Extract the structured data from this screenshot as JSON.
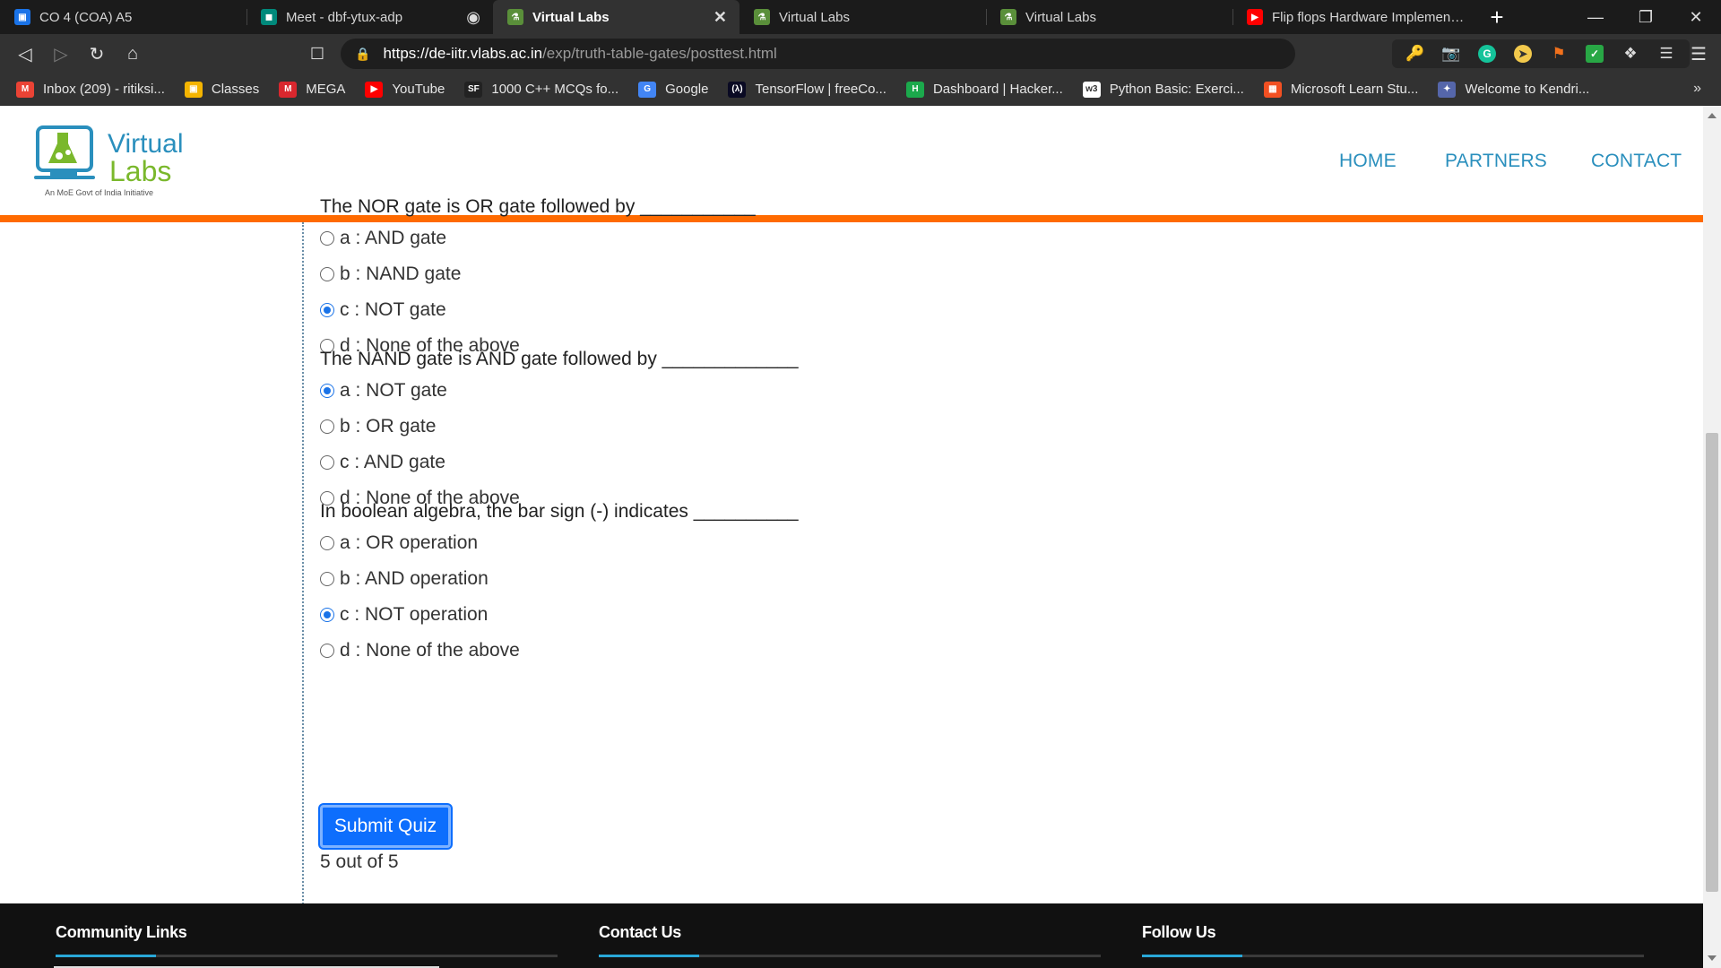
{
  "browser": {
    "tabs": [
      {
        "title": "CO 4 (COA) A5",
        "icon": "classroom-icon",
        "color": "#1a73e8",
        "active": false
      },
      {
        "title": "Meet - dbf-ytux-adp",
        "icon": "meet-icon",
        "color": "#00897b",
        "active": false,
        "recording": true
      },
      {
        "title": "Virtual Labs",
        "icon": "virtual-labs-icon",
        "color": "#5a8f3a",
        "active": true
      },
      {
        "title": "Virtual Labs",
        "icon": "virtual-labs-icon",
        "color": "#5a8f3a",
        "active": false
      },
      {
        "title": "Virtual Labs",
        "icon": "virtual-labs-icon",
        "color": "#5a8f3a",
        "active": false
      },
      {
        "title": "Flip flops Hardware Implementation",
        "icon": "youtube-icon",
        "color": "#ff0000",
        "active": false
      }
    ],
    "url_host": "https://de-iitr.vlabs.ac.in",
    "url_path": "/exp/truth-table-gates/posttest.html",
    "shield_badge": "1",
    "rewards_badge": "1",
    "bookmarks": [
      {
        "label": "Inbox (209) - ritiksi...",
        "icon": "gmail-icon",
        "color": "#ea4335",
        "glyph": "M"
      },
      {
        "label": "Classes",
        "icon": "classroom-icon",
        "color": "#f4b400",
        "glyph": "▣"
      },
      {
        "label": "MEGA",
        "icon": "mega-icon",
        "color": "#d9272e",
        "glyph": "M"
      },
      {
        "label": "YouTube",
        "icon": "youtube-icon",
        "color": "#ff0000",
        "glyph": "▶"
      },
      {
        "label": "1000 C++ MCQs fo...",
        "icon": "sanfoundry-icon",
        "color": "#222222",
        "glyph": "SF"
      },
      {
        "label": "Google",
        "icon": "google-icon",
        "color": "#4285f4",
        "glyph": "G"
      },
      {
        "label": "TensorFlow | freeCo...",
        "icon": "freecodecamp-icon",
        "color": "#0a0a23",
        "glyph": "(λ)"
      },
      {
        "label": "Dashboard | Hacker...",
        "icon": "hackerrank-icon",
        "color": "#1ba94c",
        "glyph": "H"
      },
      {
        "label": "Python Basic: Exerci...",
        "icon": "w3resource-icon",
        "color": "#ffffff",
        "glyph": "w3"
      },
      {
        "label": "Microsoft Learn Stu...",
        "icon": "microsoft-icon",
        "color": "#f25022",
        "glyph": "▦"
      },
      {
        "label": "Welcome to Kendri...",
        "icon": "kendriya-icon",
        "color": "#5566aa",
        "glyph": "✦"
      }
    ]
  },
  "site": {
    "logo_text_top": "Virtual",
    "logo_text_bottom": "Labs",
    "logo_tagline": "An MoE Govt of India Initiative",
    "nav": {
      "home": "HOME",
      "partners": "PARTNERS",
      "contact": "CONTACT"
    },
    "accent_color": "#ff6a00",
    "link_color": "#2a8fbd"
  },
  "quiz": {
    "questions": [
      {
        "text": "The NOR gate is OR gate followed by ___________",
        "options": [
          "a : AND gate",
          "b : NAND gate",
          "c : NOT gate",
          "d : None of the above"
        ],
        "selected": 2
      },
      {
        "text": "The NAND gate is AND gate followed by _____________",
        "options": [
          "a : NOT gate",
          "b : OR gate",
          "c : AND gate",
          "d : None of the above"
        ],
        "selected": 0
      },
      {
        "text": "In boolean algebra, the bar sign (-) indicates __________",
        "options": [
          "a : OR operation",
          "b : AND operation",
          "c : NOT operation",
          "d : None of the above"
        ],
        "selected": 2
      }
    ],
    "submit_label": "Submit Quiz",
    "score_text": "5 out of 5"
  },
  "footer": {
    "community": "Community Links",
    "contact": "Contact Us",
    "follow": "Follow Us"
  }
}
